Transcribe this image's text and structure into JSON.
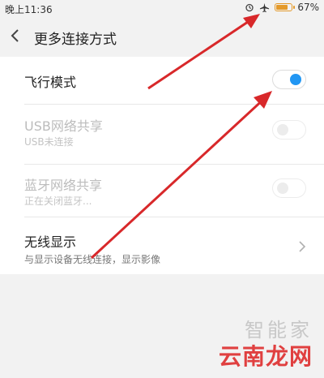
{
  "status_bar": {
    "time": "晚上11:36",
    "battery": "67%",
    "battery_level": 0.67,
    "icons": [
      "alarm-icon",
      "airplane-icon",
      "battery-icon"
    ]
  },
  "header": {
    "title": "更多连接方式",
    "back_icon": "chevron-left-icon"
  },
  "settings": {
    "airplane": {
      "title": "飞行模式",
      "enabled": true
    },
    "usb_tethering": {
      "title": "USB网络共享",
      "subtitle": "USB未连接",
      "enabled": false,
      "disabled": true
    },
    "bluetooth_tethering": {
      "title": "蓝牙网络共享",
      "subtitle": "正在关闭蓝牙...",
      "enabled": false,
      "disabled": true
    },
    "wireless_display": {
      "title": "无线显示",
      "subtitle": "与显示设备无线连接，显示影像",
      "icon": "chevron-right-icon"
    }
  },
  "watermark": {
    "line1": "智能家",
    "line2": "云南龙网"
  },
  "colors": {
    "accent": "#2196f3",
    "arrow": "#d8282a",
    "battery": "#e49a2b"
  }
}
